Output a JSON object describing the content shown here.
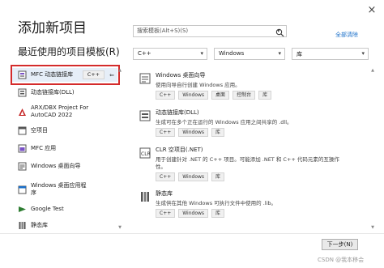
{
  "window": {
    "close_glyph": "×"
  },
  "header": {
    "title": "添加新项目",
    "recent_title": "最近使用的项目模板(R)"
  },
  "search": {
    "placeholder": "搜索模板(Alt+S)(S)",
    "clear_all": "全部清除"
  },
  "filters": [
    {
      "value": "C++"
    },
    {
      "value": "Windows"
    },
    {
      "value": "库"
    }
  ],
  "recent": [
    {
      "label": "MFC 动态链接库",
      "tag": "C++",
      "pin": "⇐",
      "icon": "mfc-dll-icon"
    },
    {
      "label": "动态链接库(DLL)",
      "tag": "",
      "pin": "",
      "icon": "dll-icon"
    },
    {
      "label": "ARX/DBX Project For AutoCAD 2022",
      "tag": "",
      "pin": "",
      "icon": "autocad-icon"
    },
    {
      "label": "空项目",
      "tag": "",
      "pin": "",
      "icon": "empty-project-icon"
    },
    {
      "label": "MFC 应用",
      "tag": "",
      "pin": "",
      "icon": "mfc-app-icon"
    },
    {
      "label": "Windows 桌面向导",
      "tag": "",
      "pin": "",
      "icon": "desktop-wizard-icon"
    },
    {
      "label": "Windows 桌面应用程序",
      "tag": "",
      "pin": "",
      "icon": "desktop-app-icon"
    },
    {
      "label": "Google Test",
      "tag": "",
      "pin": "",
      "icon": "google-test-icon"
    },
    {
      "label": "静态库",
      "tag": "",
      "pin": "",
      "icon": "static-lib-icon"
    }
  ],
  "templates": [
    {
      "name": "Windows 桌面向导",
      "desc": "使用向导自行创建 Windows 应用。",
      "desc2": "",
      "tags": [
        "C++",
        "Windows",
        "桌面",
        "控制台",
        "库"
      ],
      "icon": "desktop-wizard-icon"
    },
    {
      "name": "动态链接库(DLL)",
      "desc": "生成可在多个正在运行的 Windows 应用之间共享的 .dll。",
      "desc2": "",
      "tags": [
        "C++",
        "Windows",
        "库"
      ],
      "icon": "dll-icon"
    },
    {
      "name": "CLR 空项目(.NET)",
      "desc": "用于创建针对 .NET 的 C++ 项目。可能添加 .NET 和 C++ 代码元素的互操作",
      "desc2": "性。",
      "tags": [
        "C++",
        "Windows",
        "库"
      ],
      "icon": "clr-icon"
    },
    {
      "name": "静态库",
      "desc": "生成供在其他 Windows 可执行文件中使用的 .lib。",
      "desc2": "",
      "tags": [
        "C++",
        "Windows",
        "库"
      ],
      "icon": "static-lib-icon"
    }
  ],
  "footer": {
    "next_label": "下一步(N)"
  },
  "watermark": "CSDN @我本移会"
}
